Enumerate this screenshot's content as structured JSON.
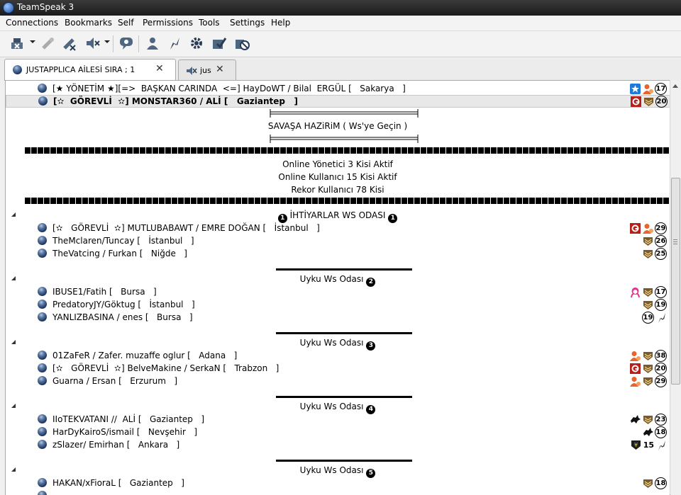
{
  "window": {
    "title": "TeamSpeak 3"
  },
  "menu": [
    "Connections",
    "Bookmarks",
    "Self",
    "Permissions",
    "Tools",
    "Settings",
    "Help"
  ],
  "toolbar": [
    "connect-icon",
    "disconnect-icon",
    "mute-microphone-icon",
    "mute-speakers-icon",
    "chat-icon",
    "contacts-icon",
    "away-icon",
    "settings-icon",
    "check-icon",
    "no-record-icon"
  ],
  "tabs": [
    {
      "label": "JUSTAPPLICA AİLESİ SIRA ; 1",
      "close": "✕"
    },
    {
      "label": "jus",
      "close": "✕"
    }
  ],
  "tree": {
    "top_users": [
      {
        "name": "[★ YÖNETİM ★][=>  BAŞKAN CARINDA  <=] HayDoWT / Bilal  ERGÜL [   Sakarya   ]",
        "bold": false,
        "badges": [
          "star-badge-icon",
          "orange-person-icon"
        ],
        "num": "17"
      },
      {
        "name": "[✫  GÖREVLİ  ✫] MONSTAR360 / ALİ [   Gaziantep   ]",
        "bold": true,
        "badges": [
          "red-g-badge-icon",
          "brown-rank-icon"
        ],
        "num": "20"
      }
    ],
    "savas": "SAVAŞA HAZiRiM ( Ws'ye Geçin )",
    "info_lines": [
      "Online Yönetici 3 Kisi Aktif",
      "Online Kullanıcı 15 Kisi Aktif",
      "Rekor Kullanıcı 78 Kisi"
    ],
    "channels": [
      {
        "name": "İHTİYARLAR WS ODASI",
        "num": "1",
        "style": "dualnum",
        "users": [
          {
            "name": "[✫   GÖREVLİ  ✫] MUTLUBABAWT / EMRE DOĞAN [   İstanbul   ]",
            "badges": [
              "red-g-badge-icon",
              "orange-person-icon"
            ],
            "num": "29"
          },
          {
            "name": "TheMclaren/Tuncay [   İstanbul   ]",
            "badges": [
              "brown-rank-icon"
            ],
            "num": "26"
          },
          {
            "name": "TheVatcing / Furkan [   Niğde   ]",
            "badges": [
              "brown-rank-icon"
            ],
            "num": "25"
          }
        ]
      },
      {
        "name": "Uyku  Ws Odası",
        "num": "2",
        "style": "line",
        "users": [
          {
            "name": "IBUSE1/Fatih [   Bursa   ]",
            "badges": [
              "pink-hair-icon",
              "brown-rank-icon"
            ],
            "num": "17"
          },
          {
            "name": "PredatoryJY/Göktug [   İstanbul   ]",
            "badges": [
              "brown-rank-icon"
            ],
            "num": "19"
          },
          {
            "name": "YANLIZBASINA / enes [   Bursa   ]",
            "badges": [],
            "num": "19",
            "after": "feather-icon"
          }
        ]
      },
      {
        "name": "Uyku  Ws Odası",
        "num": "3",
        "style": "line",
        "users": [
          {
            "name": "01ZaFeR / Zafer. muzaffe oglur [   Adana   ]",
            "badges": [
              "orange-person-icon",
              "brown-rank-icon"
            ],
            "num": "38"
          },
          {
            "name": "[✫   GÖREVLİ  ✫] BelveMakine / SerkaN [   Trabzon   ]",
            "badges": [
              "red-g-badge-icon",
              "brown-rank-icon"
            ],
            "num": "20"
          },
          {
            "name": "Guarna / Ersan [   Erzurum   ]",
            "badges": [
              "orange-person-icon",
              "brown-rank-icon"
            ],
            "num": "29"
          }
        ]
      },
      {
        "name": "Uyku  Ws Odası",
        "num": "4",
        "style": "line",
        "users": [
          {
            "name": "IIoTEKVATANI //  ALİ [   Gaziantep   ]",
            "badges": [
              "wolf-icon",
              "brown-rank-icon"
            ],
            "num": "23"
          },
          {
            "name": "HarDyKairoS/ismail [   Nevşehir   ]",
            "badges": [
              "wolf-icon"
            ],
            "num": "18"
          },
          {
            "name": "zSlazer/ Emirhan [   Ankara   ]",
            "badges": [
              "yen-shield-icon"
            ],
            "plain": "15",
            "after": "feather-icon"
          }
        ]
      },
      {
        "name": "Uyku  Ws Odası",
        "num": "5",
        "style": "line",
        "users": [
          {
            "name": "HAKAN/xFioraL [   Gaziantep   ]",
            "badges": [
              "brown-rank-icon"
            ],
            "num": "18"
          }
        ]
      }
    ]
  }
}
